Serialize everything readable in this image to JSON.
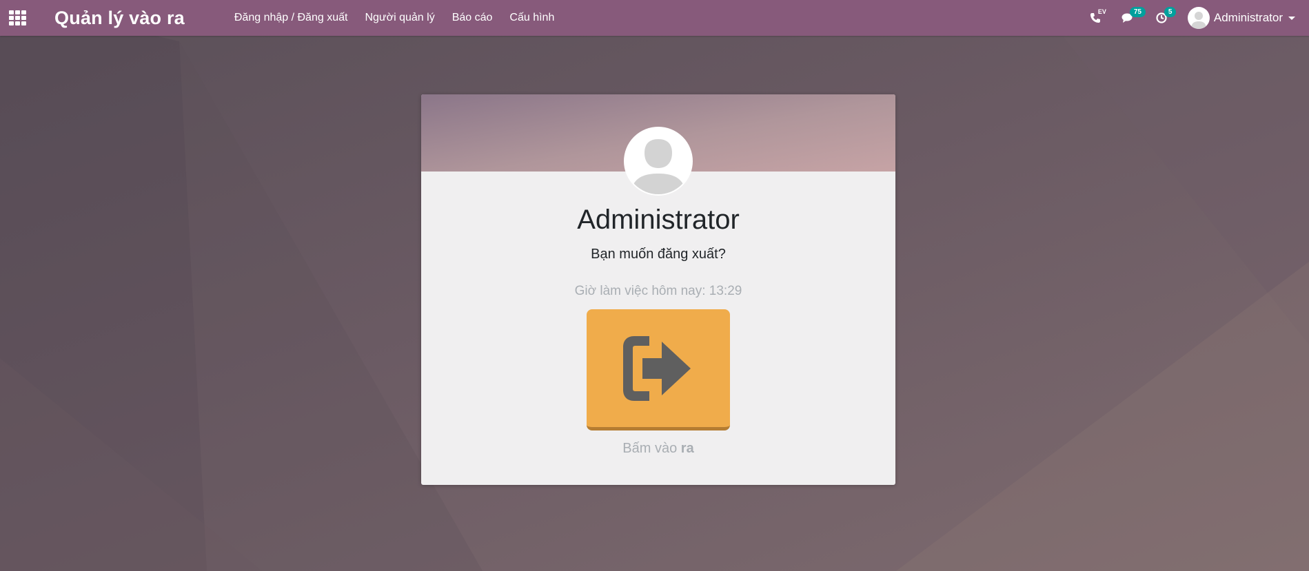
{
  "navbar": {
    "brand": "Quản lý vào ra",
    "menu": [
      "Đăng nhập / Đăng xuất",
      "Người quản lý",
      "Báo cáo",
      "Cấu hình"
    ],
    "systray": {
      "voip_tag": "EV",
      "messages_count": "75",
      "activities_count": "5",
      "user_name": "Administrator"
    }
  },
  "card": {
    "employee_name": "Administrator",
    "question": "Bạn muốn đăng xuất?",
    "hours_label": "Giờ làm việc hôm nay: 13:29",
    "click_prefix": "Bấm vào",
    "click_action": "ra"
  },
  "colors": {
    "navbar": "#875a7b",
    "badge": "#00a09d",
    "button": "#f0ac4b",
    "button_icon": "#5f5f5f"
  }
}
